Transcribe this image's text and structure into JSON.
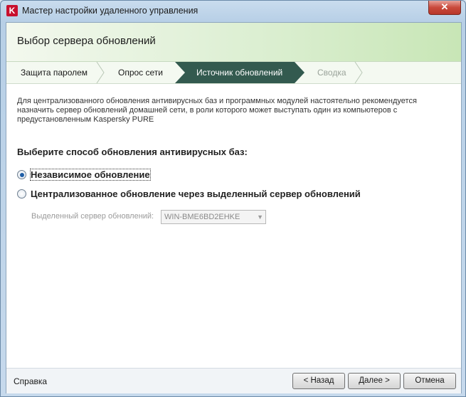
{
  "window": {
    "title": "Мастер настройки удаленного управления",
    "close_label": "✕",
    "app_icon_letter": "K"
  },
  "header": {
    "title": "Выбор сервера обновлений"
  },
  "steps": [
    {
      "label": "Защита паролем",
      "state": "done"
    },
    {
      "label": "Опрос сети",
      "state": "done"
    },
    {
      "label": "Источник обновлений",
      "state": "active"
    },
    {
      "label": "Сводка",
      "state": "disabled"
    }
  ],
  "description": "Для централизованного обновления антивирусных баз и программных модулей настоятельно рекомендуется назначить сервер обновлений домашней сети, в роли которого может выступать один из компьютеров с предустановленным Kaspersky PURE",
  "question": "Выберите способ обновления антивирусных баз:",
  "options": [
    {
      "label": "Независимое обновление",
      "checked": true
    },
    {
      "label": "Централизованное обновление через выделенный сервер обновлений",
      "checked": false
    }
  ],
  "server": {
    "label": "Выделенный сервер обновлений:",
    "value": "WIN-BME6BD2EHKE"
  },
  "footer": {
    "help": "Справка",
    "back": "< Назад",
    "next": "Далее >",
    "cancel": "Отмена"
  },
  "colors": {
    "active_step": "#335a4f",
    "header_gradient_end": "#c8e6b6"
  }
}
